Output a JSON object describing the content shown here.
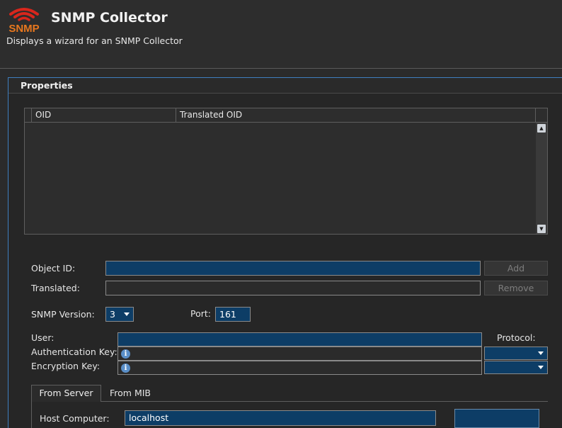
{
  "header": {
    "logo_text": "SNMP",
    "title": "SNMP Collector",
    "subtitle": "Displays a wizard for an SNMP Collector"
  },
  "panel": {
    "title": "Properties"
  },
  "table": {
    "columns": [
      "OID",
      "Translated OID"
    ],
    "rows": []
  },
  "form": {
    "object_id": {
      "label": "Object ID:",
      "value": ""
    },
    "translated": {
      "label": "Translated:",
      "value": ""
    },
    "add_label": "Add",
    "remove_label": "Remove",
    "snmp_version": {
      "label": "SNMP Version:",
      "value": "3"
    },
    "port": {
      "label": "Port:",
      "value": "161"
    },
    "user": {
      "label": "User:",
      "value": ""
    },
    "protocol_label": "Protocol:",
    "auth_key": {
      "label": "Authentication Key:",
      "value": "",
      "protocol": ""
    },
    "enc_key": {
      "label": "Encryption Key:",
      "value": "",
      "protocol": ""
    }
  },
  "tabs": [
    {
      "label": "From Server",
      "active": true
    },
    {
      "label": "From MIB",
      "active": false
    }
  ],
  "server": {
    "host_label": "Host Computer:",
    "host_value": "localhost"
  },
  "colors": {
    "accent": "#3f7fc0",
    "field_blue": "#0d3d66",
    "logo_red": "#d9261c",
    "logo_orange": "#e8771e"
  },
  "icons": [
    "snmp-logo-icon",
    "scroll-up-icon",
    "scroll-down-icon",
    "info-icon",
    "chevron-down-icon"
  ]
}
